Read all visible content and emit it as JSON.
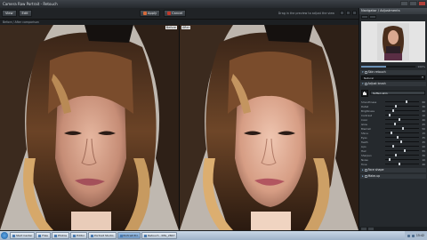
{
  "window": {
    "title": "Camera Raw Portrait - Retouch"
  },
  "toolbar": {
    "left_buttons": [
      "View",
      "Edit"
    ],
    "apply_label": "Apply",
    "cancel_label": "Cancel",
    "hint": "Drag in the preview to adjust the view"
  },
  "subbar": {
    "text": "Before / After comparison"
  },
  "panes": {
    "before_label": "Before",
    "after_label": "After"
  },
  "panel": {
    "title": "Navigator / Adjustments",
    "zoom_value": "100%",
    "zoom_level": 0.45,
    "section1": "Skin retouch",
    "preset": "Natural",
    "section2": "Adjust brush",
    "tool_label": "Soften skin",
    "sliders": [
      {
        "name": "Smoothness",
        "value": "60",
        "pos": 0.6
      },
      {
        "name": "Detail",
        "value": "30",
        "pos": 0.3
      },
      {
        "name": "Brightness",
        "value": "20",
        "pos": 0.2
      },
      {
        "name": "Contrast",
        "value": "10",
        "pos": 0.1
      },
      {
        "name": "Color",
        "value": "40",
        "pos": 0.4
      },
      {
        "name": "Glow",
        "value": "25",
        "pos": 0.25
      },
      {
        "name": "Blemish",
        "value": "50",
        "pos": 0.5
      },
      {
        "name": "Shine",
        "value": "15",
        "pos": 0.15
      },
      {
        "name": "Eyes",
        "value": "35",
        "pos": 0.35
      },
      {
        "name": "Teeth",
        "value": "45",
        "pos": 0.45
      },
      {
        "name": "Lips",
        "value": "20",
        "pos": 0.2
      },
      {
        "name": "Hair",
        "value": "55",
        "pos": 0.55
      },
      {
        "name": "Sharpen",
        "value": "30",
        "pos": 0.3
      },
      {
        "name": "Noise",
        "value": "10",
        "pos": 0.1
      },
      {
        "name": "Tone",
        "value": "40",
        "pos": 0.4
      }
    ],
    "section3": "Face shape",
    "section4": "Make-up"
  },
  "taskbar": {
    "items": [
      {
        "label": "Start Center",
        "active": false
      },
      {
        "label": "Files",
        "active": false
      },
      {
        "label": "Photos",
        "active": false
      },
      {
        "label": "Editor",
        "active": false
      },
      {
        "label": "Portrait Studio",
        "active": false
      },
      {
        "label": "Portrait Pro",
        "active": true
      },
      {
        "label": "Retouch - IMG_2847",
        "active": false
      }
    ],
    "clock": "15:42"
  }
}
